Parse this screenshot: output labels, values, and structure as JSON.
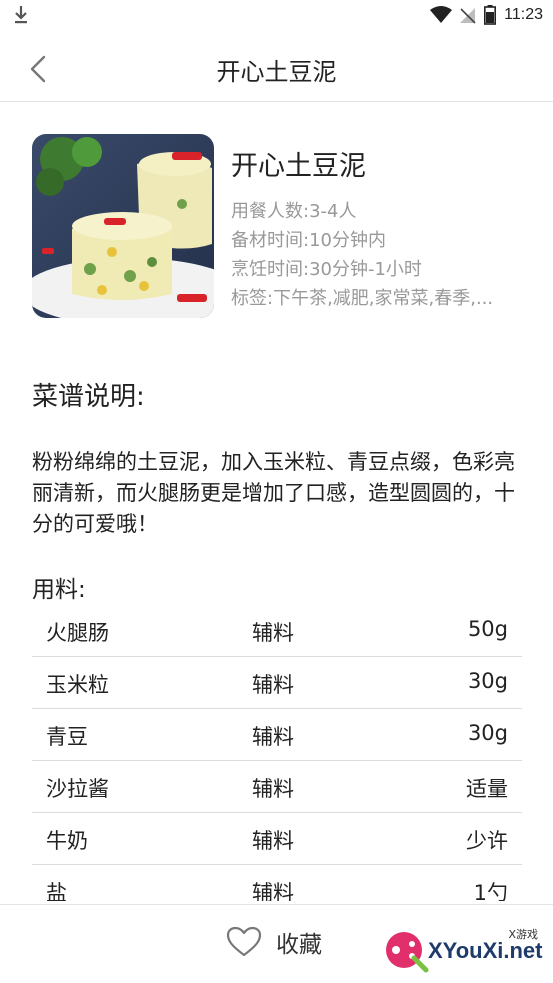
{
  "status_bar": {
    "time": "11:23"
  },
  "toolbar": {
    "title": "开心土豆泥"
  },
  "recipe": {
    "name": "开心土豆泥",
    "servings": "用餐人数:3-4人",
    "prep_time": "备材时间:10分钟内",
    "cook_time": "烹饪时间:30分钟-1小时",
    "tags": "标签:下午茶,减肥,家常菜,春季,..."
  },
  "description": {
    "heading": "菜谱说明:",
    "text": "粉粉绵绵的土豆泥，加入玉米粒、青豆点缀，色彩亮丽清新，而火腿肠更是增加了口感，造型圆圆的，十分的可爱哦！"
  },
  "ingredients": {
    "heading": "用料:",
    "rows": [
      {
        "name": "火腿肠",
        "type": "辅料",
        "amount": "50g"
      },
      {
        "name": "玉米粒",
        "type": "辅料",
        "amount": "30g"
      },
      {
        "name": "青豆",
        "type": "辅料",
        "amount": "30g"
      },
      {
        "name": "沙拉酱",
        "type": "辅料",
        "amount": "适量"
      },
      {
        "name": "牛奶",
        "type": "辅料",
        "amount": "少许"
      },
      {
        "name": "盐",
        "type": "辅料",
        "amount": "1勺"
      }
    ]
  },
  "bottom_bar": {
    "favorite_label": "收藏"
  },
  "watermark": {
    "text": "XYouXi.net",
    "sub": "X游戏"
  },
  "icons": [
    "download-icon",
    "wifi-icon",
    "signal-icon",
    "battery-icon",
    "back-arrow-icon",
    "heart-icon"
  ]
}
